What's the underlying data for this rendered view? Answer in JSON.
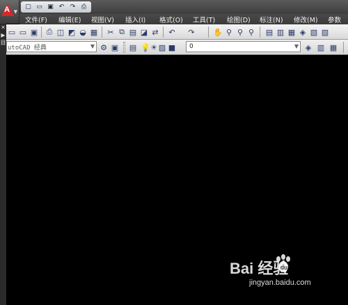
{
  "quick_access": {
    "icons": [
      "new-icon",
      "open-icon",
      "save-icon",
      "undo-icon",
      "redo-icon",
      "plot-icon"
    ],
    "glyphs": [
      "▢",
      "▭",
      "▣",
      "↶",
      "↷",
      "⎙"
    ]
  },
  "menu": {
    "items": [
      "文件(F)",
      "编辑(E)",
      "视图(V)",
      "插入(I)",
      "格式(O)",
      "工具(T)",
      "绘图(D)",
      "标注(N)",
      "修改(M)",
      "参数"
    ]
  },
  "left_strip": {
    "glyphs": [
      "✕",
      "▶",
      "目"
    ]
  },
  "toolbar1": {
    "glyphs": [
      "▭",
      "▭",
      "▣",
      "⎙",
      "◫",
      "◩",
      "◒",
      "▦",
      "✂",
      "⧉",
      "▤",
      "◪",
      "⇄",
      "↶",
      "↷",
      "✋",
      "⚲",
      "⚲",
      "⚲",
      "▤",
      "▥",
      "▦",
      "◈",
      "▧",
      "▨"
    ]
  },
  "toolbar2": {
    "workspace_value": "utoCAD 经典",
    "workspace_glyphs": [
      "⚙",
      "▣"
    ],
    "layer_glyphs": [
      "▤",
      "💡",
      "☀",
      "▨",
      "■"
    ],
    "layer_value": "0",
    "right_glyphs": [
      "◈",
      "▥",
      "▦"
    ]
  },
  "watermark": {
    "text": "Bai 经验",
    "url": "jingyan.baidu.com"
  },
  "colors": {
    "canvas": "#000000",
    "toolbar": "#e4e4e4",
    "menubar": "#404040",
    "logo": "#d8262b"
  }
}
